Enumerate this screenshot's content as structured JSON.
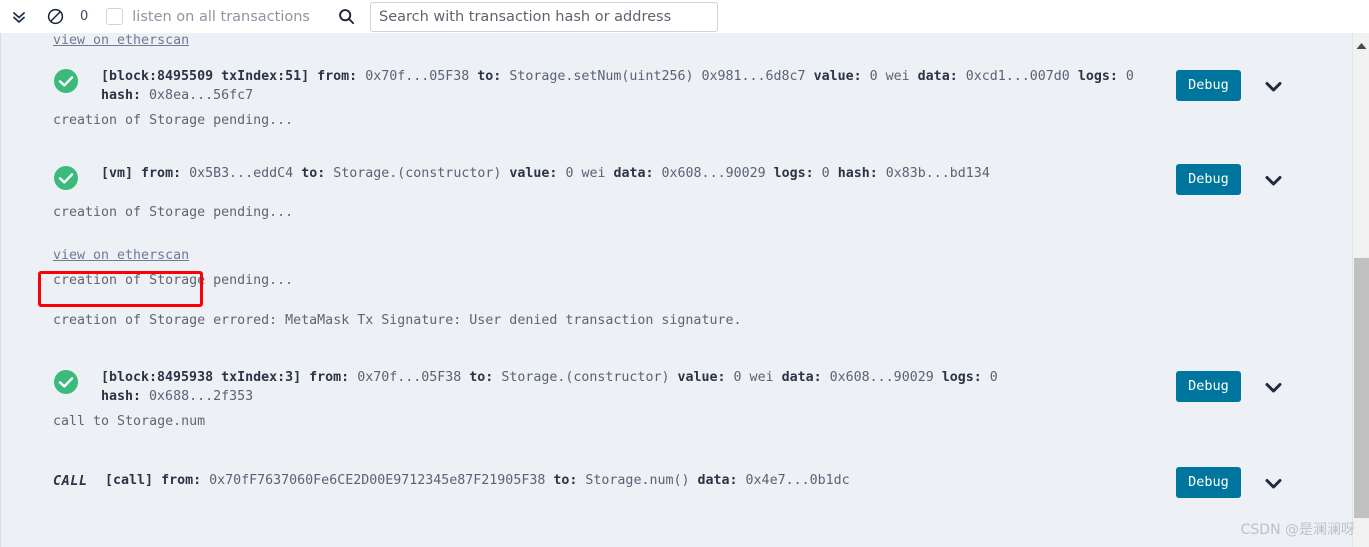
{
  "toolbar": {
    "collapse_icon": "double-chevron-down-icon",
    "ban_icon": "no-entry-icon",
    "pending_count": "0",
    "listen_label": "listen on all transactions",
    "listen_checked": false,
    "search_icon": "search-icon",
    "search_value": "",
    "search_placeholder": "Search with transaction hash or address"
  },
  "colors": {
    "panel_bg": "#edf0f4",
    "debug_button": "#00769f",
    "success_green": "#3cba7c",
    "highlight_red": "#fb0007",
    "link": "#6f7a93",
    "scroll_thumb": "#c1c1c1"
  },
  "clipped_top_link": "view on etherscan",
  "entries": [
    {
      "id": "entry-1",
      "status_icon": "success-check-icon",
      "type": "tx",
      "line1_prefix": "[block:8495509 txIndex:51]",
      "line1": " from: 0x70f...05F38 to: Storage.setNum(uint256) 0x981...6d8c7 value: 0 wei data: 0xcd1...007d0 logs: 0",
      "from_label": "from:",
      "from_value": "0x70f...05F38",
      "to_label": "to:",
      "to_value": "Storage.setNum(uint256) 0x981...6d8c7",
      "value_label": "value:",
      "value_value": "0 wei",
      "data_label": "data:",
      "data_value": "0xcd1...007d0",
      "logs_label": "logs:",
      "logs_value": "0",
      "hash_label": "hash:",
      "hash_value": "0x8ea...56fc7",
      "sub_text": "creation of Storage pending...",
      "debug_label": "Debug",
      "chevron_icon": "chevron-down-icon"
    },
    {
      "id": "entry-2",
      "status_icon": "success-check-icon",
      "type": "vm",
      "line1_prefix": "[vm]",
      "from_label": "from:",
      "from_value": "0x5B3...eddC4",
      "to_label": "to:",
      "to_value": "Storage.(constructor)",
      "value_label": "value:",
      "value_value": "0 wei",
      "data_label": "data:",
      "data_value": "0x608...90029",
      "logs_label": "logs:",
      "logs_value": "0",
      "hash_label": "hash:",
      "hash_value": "0x83b...bd134",
      "sub_text": "creation of Storage pending...",
      "debug_label": "Debug",
      "chevron_icon": "chevron-down-icon"
    },
    {
      "id": "entry-3",
      "type": "link-only",
      "link_text": "view on etherscan",
      "sub_text": "creation of Storage pending...",
      "highlighted": true
    },
    {
      "id": "entry-4",
      "type": "error",
      "sub_text": "creation of Storage errored: MetaMask Tx Signature: User denied transaction signature."
    },
    {
      "id": "entry-5",
      "status_icon": "success-check-icon",
      "type": "tx",
      "line1_prefix": "[block:8495938 txIndex:3]",
      "from_label": "from:",
      "from_value": "0x70f...05F38",
      "to_label": "to:",
      "to_value": "Storage.(constructor)",
      "value_label": "value:",
      "value_value": "0 wei",
      "data_label": "data:",
      "data_value": "0x608...90029",
      "logs_label": "logs:",
      "logs_value": "0",
      "hash_label": "hash:",
      "hash_value": "0x688...2f353",
      "sub_text": "call to Storage.num",
      "debug_label": "Debug",
      "chevron_icon": "chevron-down-icon"
    },
    {
      "id": "entry-6",
      "type": "call",
      "call_tag": "CALL",
      "line1_prefix": "[call]",
      "from_label": "from:",
      "from_value": "0x70fF7637060Fe6CE2D00E9712345e87F21905F38",
      "to_label": "to:",
      "to_value": "Storage.num()",
      "data_label": "data:",
      "data_value": "0x4e7...0b1dc",
      "debug_label": "Debug",
      "chevron_icon": "chevron-down-icon"
    }
  ],
  "scrollbar": {
    "up_arrow_icon": "triangle-up-icon"
  },
  "watermark": "CSDN @是澜澜呀"
}
